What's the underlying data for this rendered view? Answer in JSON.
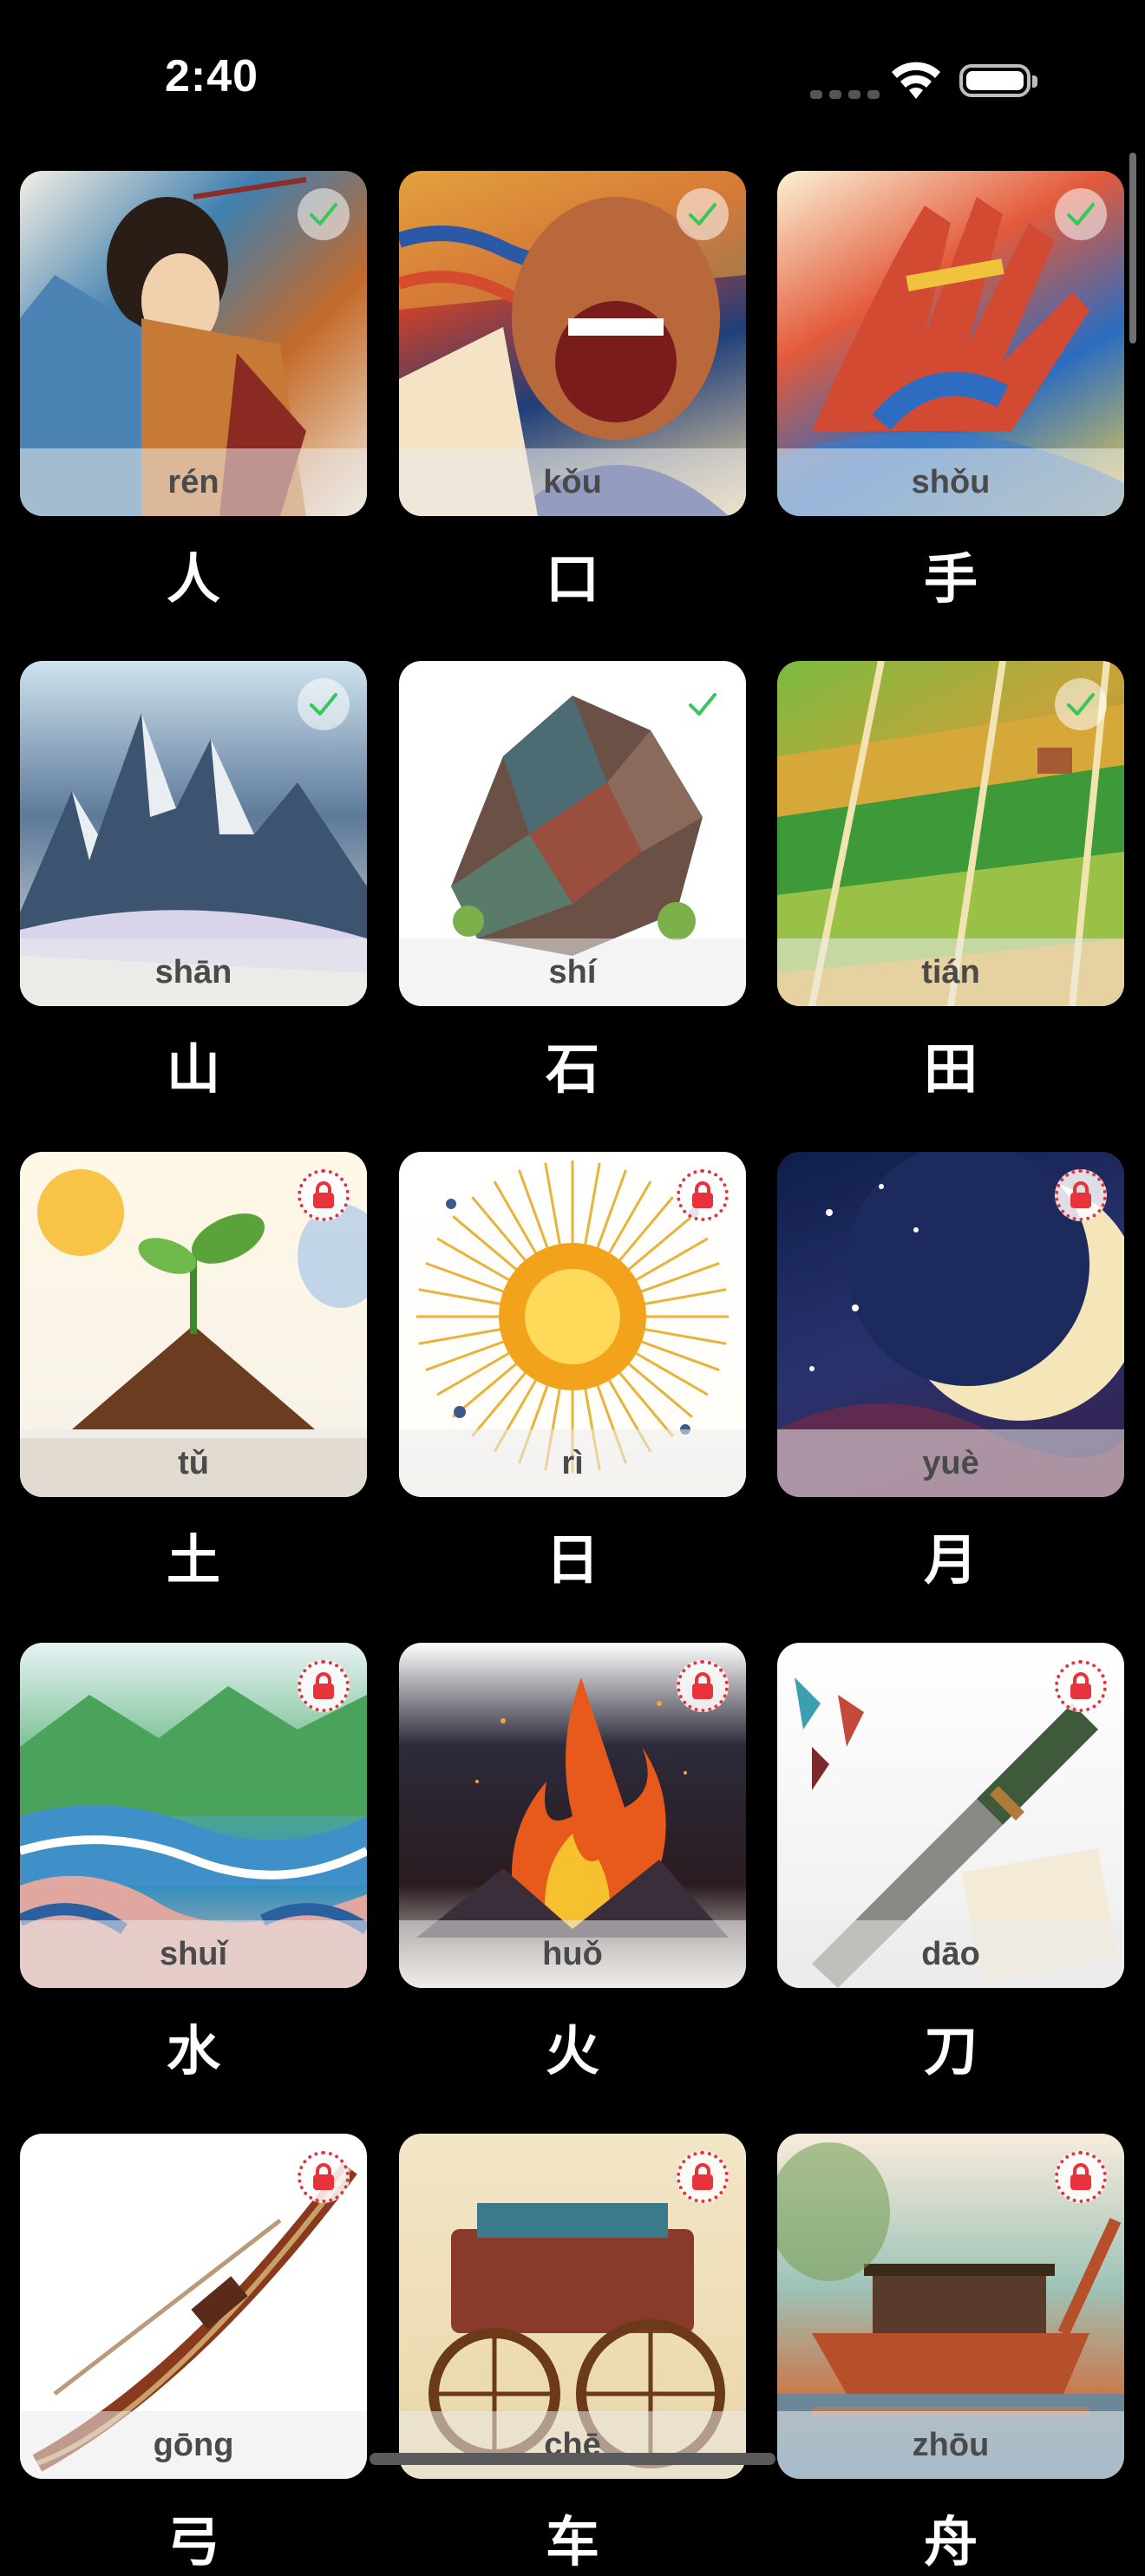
{
  "status_bar": {
    "time": "2:40"
  },
  "colors": {
    "background": "#000000",
    "check": "#34c759",
    "lock": "#e8323c"
  },
  "cards": [
    {
      "pinyin": "rén",
      "char": "人",
      "status": "done",
      "theme": "person",
      "icon": "check-icon"
    },
    {
      "pinyin": "kǒu",
      "char": "口",
      "status": "done",
      "theme": "mouth",
      "icon": "check-icon"
    },
    {
      "pinyin": "shǒu",
      "char": "手",
      "status": "done",
      "theme": "hand",
      "icon": "check-icon"
    },
    {
      "pinyin": "shān",
      "char": "山",
      "status": "done",
      "theme": "mountain",
      "icon": "check-icon"
    },
    {
      "pinyin": "shí",
      "char": "石",
      "status": "done",
      "theme": "stone",
      "icon": "check-icon"
    },
    {
      "pinyin": "tián",
      "char": "田",
      "status": "done",
      "theme": "field",
      "icon": "check-icon"
    },
    {
      "pinyin": "tǔ",
      "char": "土",
      "status": "locked",
      "theme": "earth",
      "icon": "lock-icon"
    },
    {
      "pinyin": "rì",
      "char": "日",
      "status": "locked",
      "theme": "sun",
      "icon": "lock-icon"
    },
    {
      "pinyin": "yuè",
      "char": "月",
      "status": "locked",
      "theme": "moon",
      "icon": "lock-icon"
    },
    {
      "pinyin": "shuǐ",
      "char": "水",
      "status": "locked",
      "theme": "water",
      "icon": "lock-icon"
    },
    {
      "pinyin": "huǒ",
      "char": "火",
      "status": "locked",
      "theme": "fire",
      "icon": "lock-icon"
    },
    {
      "pinyin": "dāo",
      "char": "刀",
      "status": "locked",
      "theme": "knife",
      "icon": "lock-icon"
    },
    {
      "pinyin": "gōng",
      "char": "弓",
      "status": "locked",
      "theme": "bow",
      "icon": "lock-icon"
    },
    {
      "pinyin": "chē",
      "char": "车",
      "status": "locked",
      "theme": "cart",
      "icon": "lock-icon"
    },
    {
      "pinyin": "zhōu",
      "char": "舟",
      "status": "locked",
      "theme": "boat",
      "icon": "lock-icon"
    }
  ]
}
